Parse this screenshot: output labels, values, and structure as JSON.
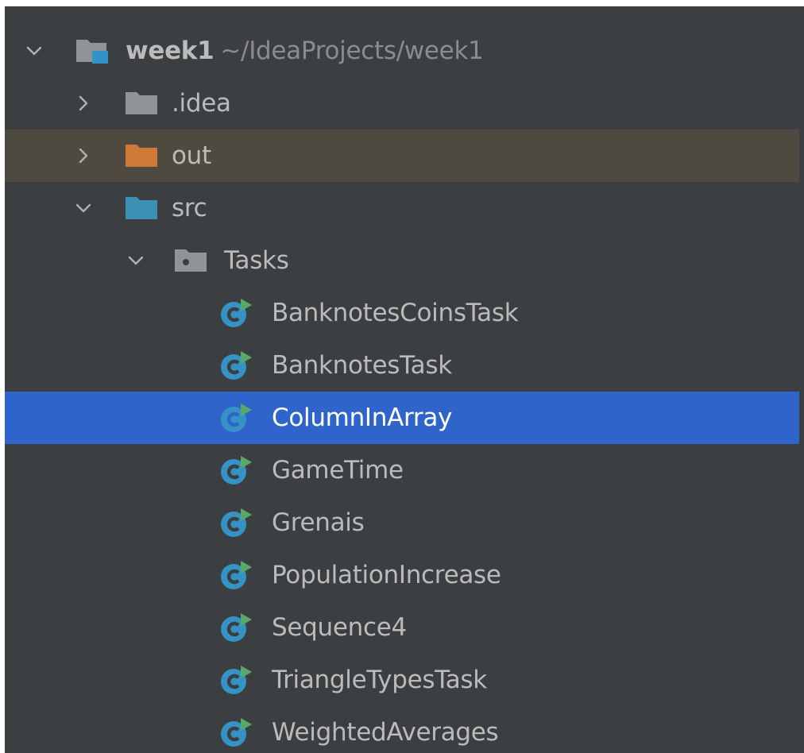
{
  "colors": {
    "panel_bg": "#3c3f41",
    "text": "#bbbbbb",
    "excluded_row_bg": "#4e4a3f",
    "selected_row_bg": "#2f65ca",
    "folder_gray": "#8f9496",
    "folder_orange": "#d07a3a",
    "folder_blue": "#3d8fb3",
    "class_icon_blue": "#3592c4",
    "run_arrow_green": "#59a869"
  },
  "tree": {
    "project": {
      "name": "week1",
      "path": "~/IdeaProjects/week1",
      "icon": "project-folder-icon",
      "expanded": true
    },
    "idea": {
      "label": ".idea",
      "icon": "folder-icon",
      "expanded": false
    },
    "out": {
      "label": "out",
      "icon": "excluded-folder-icon",
      "expanded": false
    },
    "src": {
      "label": "src",
      "icon": "source-folder-icon",
      "expanded": true
    },
    "tasks": {
      "label": "Tasks",
      "icon": "package-icon",
      "expanded": true
    },
    "classes": [
      {
        "label": "BanknotesCoinsTask",
        "icon": "runnable-class-icon"
      },
      {
        "label": "BanknotesTask",
        "icon": "runnable-class-icon"
      },
      {
        "label": "ColumnInArray",
        "icon": "runnable-class-icon",
        "selected": true
      },
      {
        "label": "GameTime",
        "icon": "runnable-class-icon"
      },
      {
        "label": "Grenais",
        "icon": "runnable-class-icon"
      },
      {
        "label": "PopulationIncrease",
        "icon": "runnable-class-icon"
      },
      {
        "label": "Sequence4",
        "icon": "runnable-class-icon"
      },
      {
        "label": "TriangleTypesTask",
        "icon": "runnable-class-icon"
      },
      {
        "label": "WeightedAverages",
        "icon": "runnable-class-icon"
      }
    ]
  }
}
